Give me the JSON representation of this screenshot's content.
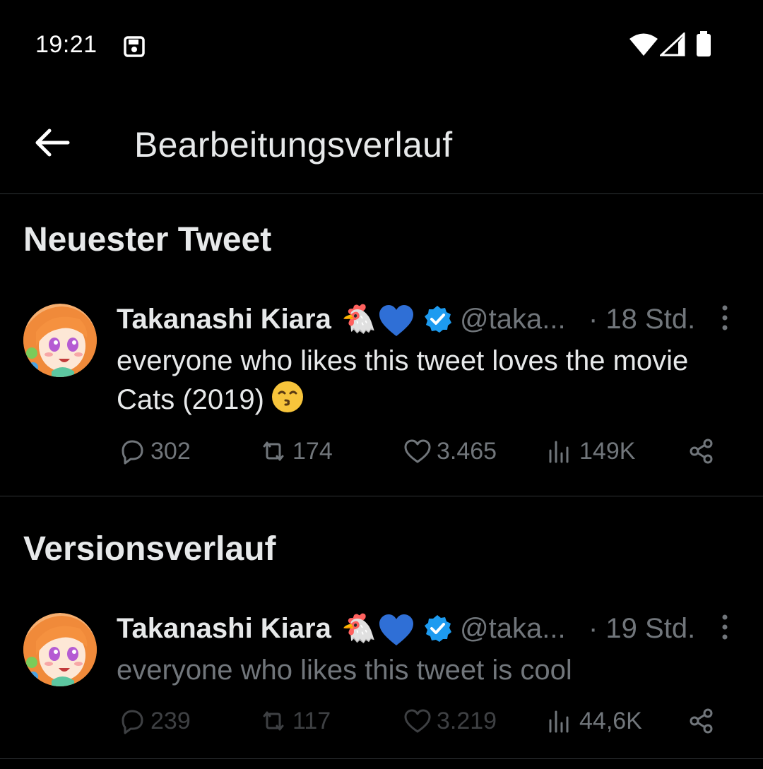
{
  "status_bar": {
    "time": "19:21",
    "icons": [
      "save-icon",
      "wifi-icon",
      "signal-icon",
      "battery-icon"
    ]
  },
  "header": {
    "title": "Bearbeitungsverlauf",
    "back_icon": "arrow-left-icon"
  },
  "latest": {
    "section_title": "Neuester Tweet",
    "tweet": {
      "display_name": "Takanashi Kiara",
      "name_emoji": "🐔",
      "heart_icon": "blue-heart-icon",
      "verified_icon": "verified-badge-icon",
      "handle": "@taka...",
      "time": "· 18 Std.",
      "text": "everyone who likes this tweet loves the movie Cats (2019)",
      "text_emoji": "kissing-face-emoji",
      "replies": "302",
      "retweets": "174",
      "likes": "3.465",
      "views": "149K"
    }
  },
  "history": {
    "section_title": "Versionsverlauf",
    "tweet": {
      "display_name": "Takanashi Kiara",
      "name_emoji": "🐔",
      "heart_icon": "blue-heart-icon",
      "verified_icon": "verified-badge-icon",
      "handle": "@taka...",
      "time": "· 19 Std.",
      "text": "everyone who likes this tweet is cool",
      "replies": "239",
      "retweets": "117",
      "likes": "3.219",
      "views": "44,6K"
    }
  },
  "colors": {
    "background": "#000000",
    "text": "#e7e9ea",
    "secondary": "#71767b",
    "accent": "#1d9bf0",
    "divider": "#2f3336",
    "blue_heart": "#2f6fd6"
  }
}
